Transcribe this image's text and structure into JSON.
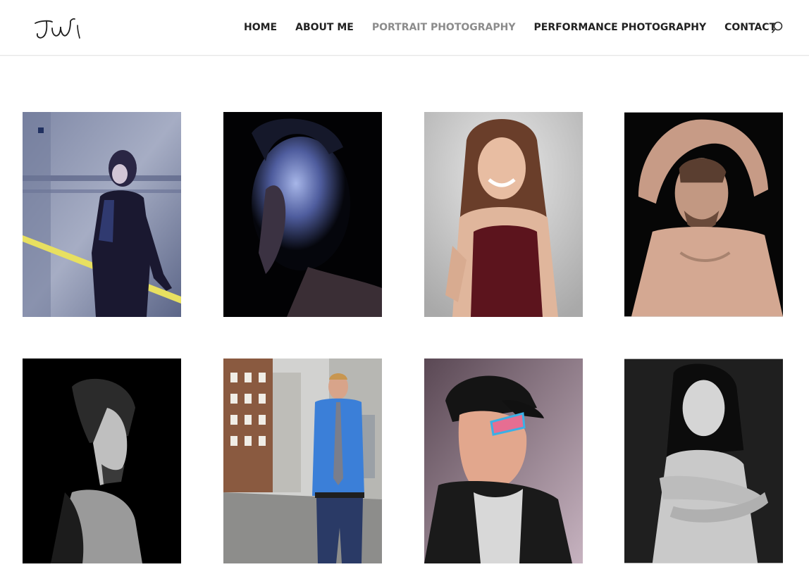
{
  "site": {
    "logo_text": "JW"
  },
  "nav": {
    "items": [
      {
        "label": "HOME",
        "active": false
      },
      {
        "label": "ABOUT ME",
        "active": false
      },
      {
        "label": "PORTRAIT PHOTOGRAPHY",
        "active": true
      },
      {
        "label": "PERFORMANCE PHOTOGRAPHY",
        "active": false
      },
      {
        "label": "CONTACT",
        "active": false
      }
    ],
    "search_icon": "search-icon"
  },
  "colors": {
    "nav_text": "#222222",
    "nav_active": "#8c8c8c",
    "divider": "#e6e6e6"
  },
  "gallery": {
    "photos": [
      {
        "subject": "woman-against-metal-wall"
      },
      {
        "subject": "woman-blue-light-profile"
      },
      {
        "subject": "smiling-woman-maroon-top"
      },
      {
        "subject": "shirtless-man-arms-raised"
      },
      {
        "subject": "man-profile-black-and-white"
      },
      {
        "subject": "man-blue-shirt-alley"
      },
      {
        "subject": "man-cap-neon-glasses"
      },
      {
        "subject": "woman-black-and-white-portrait"
      }
    ]
  }
}
